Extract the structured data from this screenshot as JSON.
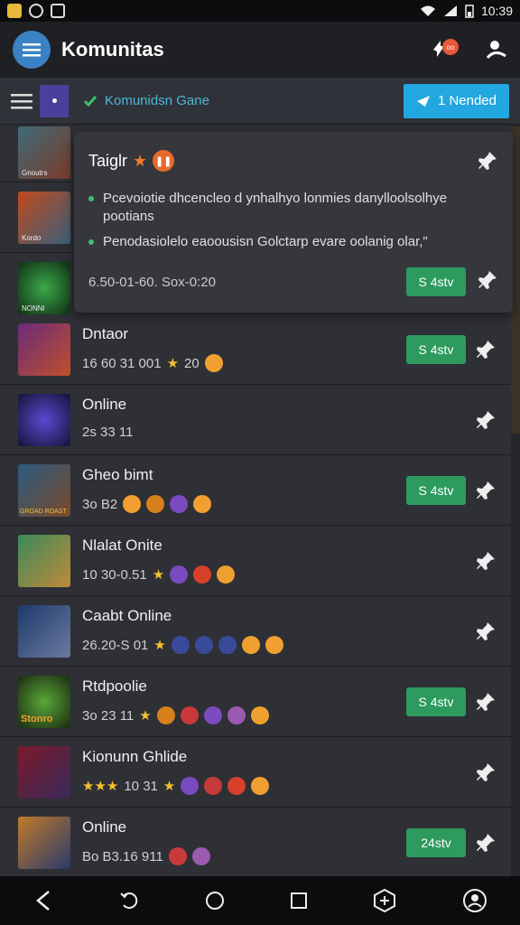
{
  "status": {
    "time": "10:39"
  },
  "appbar": {
    "title": "Komunitas"
  },
  "subbar": {
    "filter_label": "Komunidsn Gane",
    "action_label": "1 Nended"
  },
  "popup": {
    "title": "Taiglr",
    "bullets": [
      "Pcevoiotie dhcencleo d ynhalhyo lonmies danylloolsolhye pootians",
      "Penodasiolelo eaoousisn Golctarp evare oolanig olar,\""
    ],
    "meta": "6.50-01-60. Sox-0:20",
    "button_label": "S 4stv"
  },
  "rows": [
    {
      "title": "Dntaor",
      "sub": "16 60 31 001",
      "extra": "20",
      "button": "S 4stv",
      "has_button": true
    },
    {
      "title": "Online",
      "sub": "2s 33 11",
      "extra": "",
      "button": "",
      "has_button": false
    },
    {
      "title": "Gheo bimt",
      "sub": "3o B2",
      "extra": "",
      "button": "S 4stv",
      "has_button": true
    },
    {
      "title": "Nlalat Onite",
      "sub": "10 30-0.51",
      "extra": "",
      "button": "",
      "has_button": false
    },
    {
      "title": "Caabt Online",
      "sub": "26.20-S 01",
      "extra": "",
      "button": "",
      "has_button": false
    },
    {
      "title": "Rtdpoolie",
      "sub": "3o 23 11",
      "extra": "",
      "button": "S 4stv",
      "has_button": true
    },
    {
      "title": "Kionunn Ghlide",
      "sub": "10 31",
      "extra": "",
      "button": "",
      "has_button": false
    },
    {
      "title": "Online",
      "sub": "Bo B3.16 911",
      "extra": "",
      "button": "24stv",
      "has_button": true
    }
  ],
  "thumbs": [
    "Gnoutrs",
    "Kordo",
    "NONNI",
    "",
    "GROAD ROAST",
    "",
    "",
    "Stonro",
    "",
    ""
  ],
  "icons": [
    "hamburger-icon",
    "notification-icon",
    "person-icon",
    "check-icon",
    "pin-icon",
    "back-icon",
    "circle-icon",
    "square-icon"
  ],
  "colors": {
    "accent_blue": "#23a7e0",
    "accent_green": "#2d9b5e",
    "brand_blue": "#3b82c4"
  }
}
